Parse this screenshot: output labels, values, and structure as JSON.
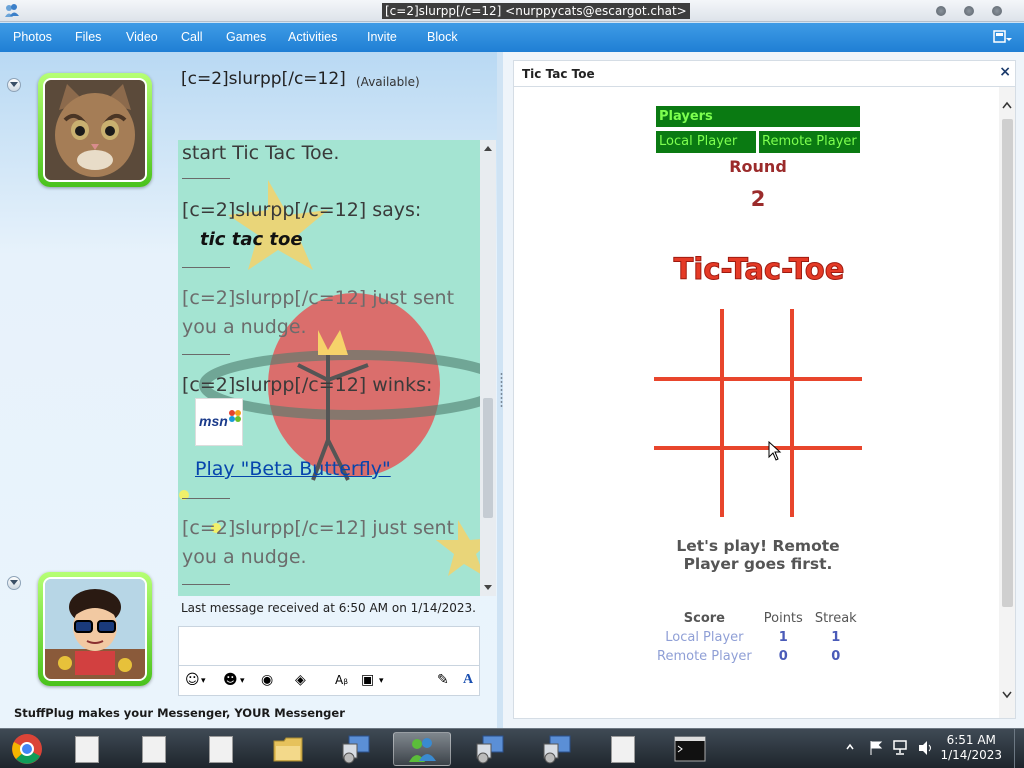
{
  "window": {
    "title": "[c=2]slurpp[/c=12] <nurppycats@escargot.chat>"
  },
  "menu": {
    "items": [
      "Photos",
      "Files",
      "Video",
      "Call",
      "Games",
      "Activities",
      "Invite",
      "Block"
    ]
  },
  "contact": {
    "name": "[c=2]slurpp[/c=12]",
    "status": "(Available)"
  },
  "conversation": {
    "lines": [
      "start Tic Tac Toe.",
      "[c=2]slurpp[/c=12] says:",
      "tic tac toe",
      "[c=2]slurpp[/c=12] just sent",
      "you a nudge.",
      "[c=2]slurpp[/c=12] winks:",
      "Play \"Beta Butterfly\"",
      "[c=2]slurpp[/c=12] just sent",
      "you a nudge."
    ],
    "wink_logo_text": "msn",
    "last_message": "Last message received at 6:50 AM on 1/14/2023."
  },
  "footer": {
    "stuffplug": "StuffPlug makes your Messenger, YOUR Messenger"
  },
  "game_panel": {
    "title": "Tic Tac Toe",
    "close": "×",
    "players_header": "Players",
    "local_player": "Local Player",
    "remote_player": "Remote Player",
    "round_label": "Round",
    "round_number": "2",
    "logo_text": "Tic-Tac-Toe",
    "message": "Let's play! Remote Player goes first.",
    "score": {
      "headers": [
        "Score",
        "Points",
        "Streak"
      ],
      "rows": [
        {
          "name": "Local Player",
          "points": "1",
          "streak": "1"
        },
        {
          "name": "Remote Player",
          "points": "0",
          "streak": "0"
        }
      ]
    }
  },
  "taskbar": {
    "time": "6:51 AM",
    "date": "1/14/2023"
  },
  "colors": {
    "menu_blue": "#1f7fd4",
    "game_green": "#0a7a12",
    "game_green_text": "#7dff4f",
    "round_red": "#9b2b2b",
    "board_red": "#e8452c"
  }
}
